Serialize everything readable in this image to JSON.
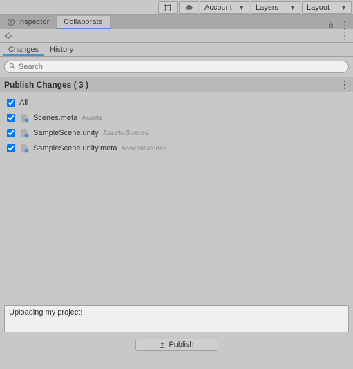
{
  "toolbar": {
    "account_label": "Account",
    "layers_label": "Layers",
    "layout_label": "Layout"
  },
  "tabs": {
    "inspector": "Inspector",
    "collaborate": "Collaborate"
  },
  "subtabs": {
    "changes": "Changes",
    "history": "History"
  },
  "search": {
    "placeholder": "Search"
  },
  "publish": {
    "header_prefix": "Publish Changes",
    "count": 3,
    "header": "Publish Changes ( 3 )",
    "all_label": "All",
    "button_label": "Publish",
    "message_value": "Uploading my project!"
  },
  "files": [
    {
      "name": "Scenes.meta",
      "path": "Assets",
      "checked": true
    },
    {
      "name": "SampleScene.unity",
      "path": "Assets\\Scenes",
      "checked": true
    },
    {
      "name": "SampleScene.unity.meta",
      "path": "Assets\\Scenes",
      "checked": true
    }
  ]
}
